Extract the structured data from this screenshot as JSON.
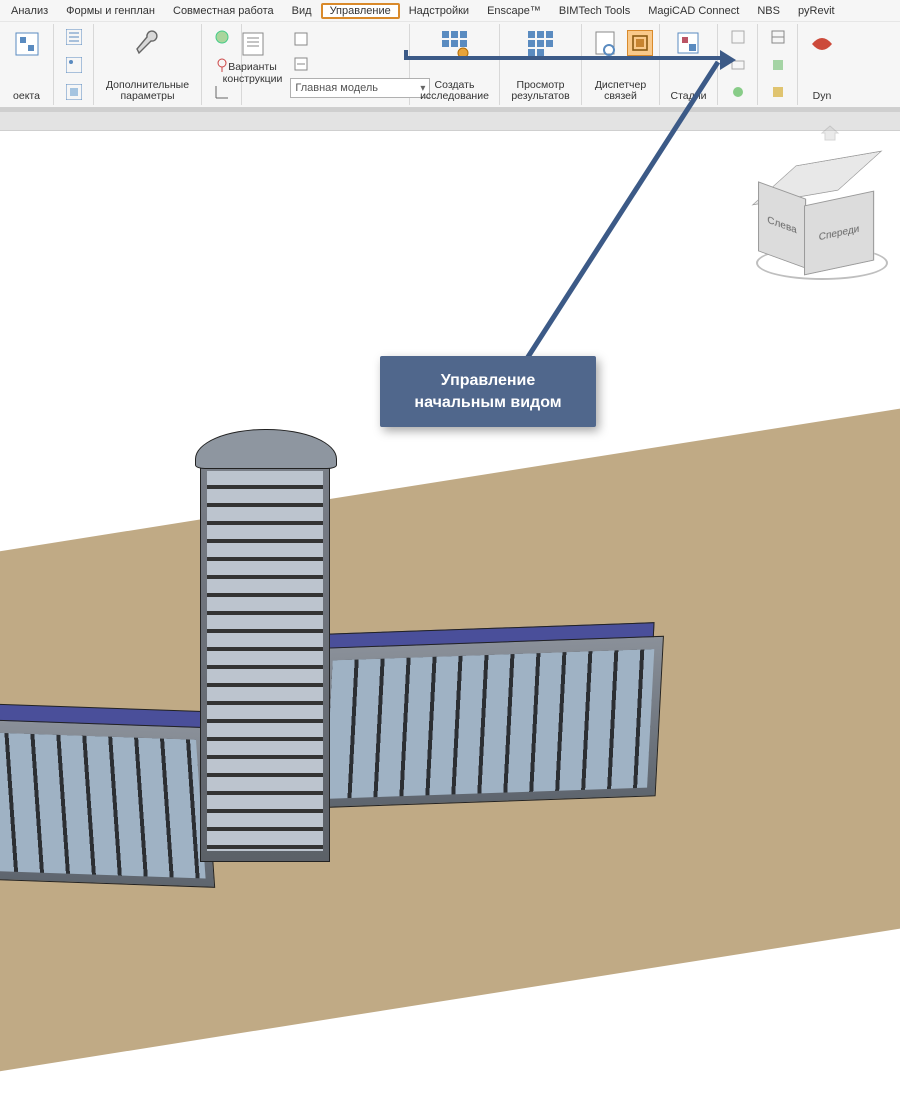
{
  "menu": {
    "items": [
      "Анализ",
      "Формы и генплан",
      "Совместная работа",
      "Вид",
      "Управление",
      "Надстройки",
      "Enscape™",
      "BIMTech Tools",
      "MagiCAD Connect",
      "NBS",
      "pyRevit"
    ],
    "active": "Управление"
  },
  "ribbon": {
    "project_panel": "оекта",
    "add_params": "Дополнительные\nпараметры",
    "design_options": "Варианты\nконструкции",
    "main_model_select": "Главная модель",
    "create_study": "Создать\nисследование",
    "view_results": "Просмотр\nрезультатов",
    "links_mgr": "Диспетчер\nсвязей",
    "stages": "Стадии",
    "dyn": "Dyn"
  },
  "viewcube": {
    "front": "Спереди",
    "left": "Слева",
    "top": ""
  },
  "callout": {
    "line1": "Управление",
    "line2": "начальным видом"
  }
}
